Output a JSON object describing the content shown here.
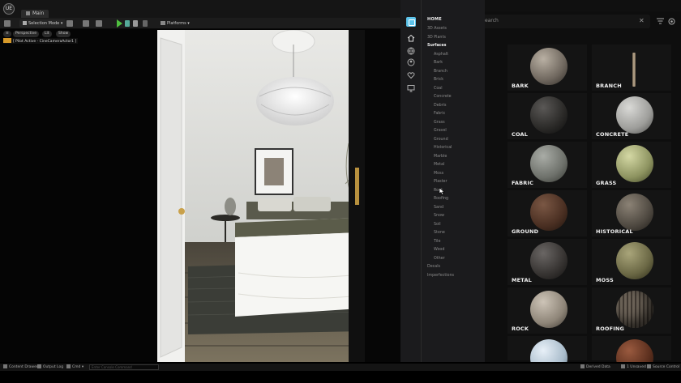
{
  "editor": {
    "logo_text": "UE",
    "map_tab": "Main",
    "toolbar": {
      "mode_label": "Selection Mode",
      "platforms_label": "Platforms"
    },
    "viewport": {
      "perspective": "Perspective",
      "lit": "Lit",
      "show": "Show",
      "pilot_label": "[ Pilot Active - CineCameraActor1 ]"
    }
  },
  "categories": {
    "home": "HOME",
    "items": [
      {
        "label": "3D Assets",
        "level": "top"
      },
      {
        "label": "3D Plants",
        "level": "top"
      },
      {
        "label": "Surfaces",
        "level": "top",
        "active": true
      },
      {
        "label": "Asphalt",
        "level": "sub"
      },
      {
        "label": "Bark",
        "level": "sub"
      },
      {
        "label": "Branch",
        "level": "sub"
      },
      {
        "label": "Brick",
        "level": "sub"
      },
      {
        "label": "Coal",
        "level": "sub"
      },
      {
        "label": "Concrete",
        "level": "sub"
      },
      {
        "label": "Debris",
        "level": "sub"
      },
      {
        "label": "Fabric",
        "level": "sub"
      },
      {
        "label": "Grass",
        "level": "sub"
      },
      {
        "label": "Gravel",
        "level": "sub"
      },
      {
        "label": "Ground",
        "level": "sub"
      },
      {
        "label": "Historical",
        "level": "sub"
      },
      {
        "label": "Marble",
        "level": "sub"
      },
      {
        "label": "Metal",
        "level": "sub"
      },
      {
        "label": "Moss",
        "level": "sub"
      },
      {
        "label": "Plaster",
        "level": "sub"
      },
      {
        "label": "Rock",
        "level": "sub"
      },
      {
        "label": "Roofing",
        "level": "sub"
      },
      {
        "label": "Sand",
        "level": "sub"
      },
      {
        "label": "Snow",
        "level": "sub"
      },
      {
        "label": "Soil",
        "level": "sub"
      },
      {
        "label": "Stone",
        "level": "sub"
      },
      {
        "label": "Tile",
        "level": "sub"
      },
      {
        "label": "Wood",
        "level": "sub"
      },
      {
        "label": "Other",
        "level": "sub"
      },
      {
        "label": "Decals",
        "level": "top"
      },
      {
        "label": "Imperfections",
        "level": "top"
      }
    ]
  },
  "browser": {
    "search_placeholder": "earch",
    "tiles": [
      {
        "name": "BARK",
        "material": "bark"
      },
      {
        "name": "BRANCH",
        "material": "branch"
      },
      {
        "name": "COAL",
        "material": "coal"
      },
      {
        "name": "CONCRETE",
        "material": "concrete"
      },
      {
        "name": "FABRIC",
        "material": "fabric"
      },
      {
        "name": "GRASS",
        "material": "grass"
      },
      {
        "name": "GROUND",
        "material": "ground"
      },
      {
        "name": "HISTORICAL",
        "material": "historical"
      },
      {
        "name": "METAL",
        "material": "metal"
      },
      {
        "name": "MOSS",
        "material": "moss"
      },
      {
        "name": "ROCK",
        "material": "rock"
      },
      {
        "name": "ROOFING",
        "material": "roofing"
      },
      {
        "name": "",
        "material": "snow"
      },
      {
        "name": "",
        "material": "soil"
      }
    ]
  },
  "statusbar": {
    "content_drawer": "Content Drawer",
    "output_log": "Output Log",
    "cmd": "Cmd",
    "console_placeholder": "Enter Console Command",
    "derived_data": "Derived Data",
    "unsaved": "1 Unsaved",
    "source_control": "Source Control"
  },
  "colors": {
    "accent": "#5cc3ea",
    "play": "#4fbf3f",
    "pilot": "#d79a2a"
  }
}
